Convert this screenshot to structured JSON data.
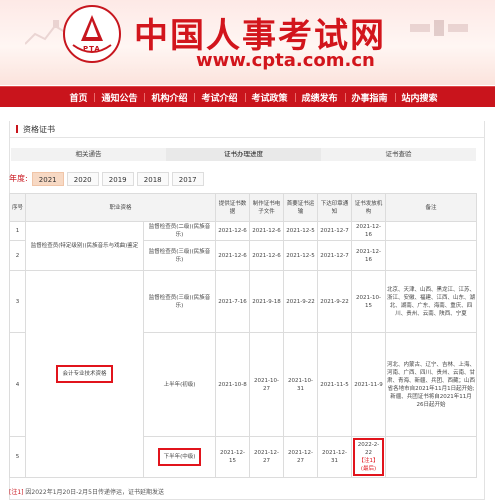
{
  "header": {
    "logo_text": "PTA",
    "site_title": "中国人事考试网",
    "site_url": "www.cpta.com.cn"
  },
  "nav": {
    "items": [
      "首页",
      "通知公告",
      "机构介绍",
      "考试介绍",
      "考试政策",
      "成绩发布",
      "办事指南",
      "站内搜索"
    ]
  },
  "section": {
    "title": "资格证书"
  },
  "tabs": [
    "相关通告",
    "证书办理进度",
    "证书查验"
  ],
  "years": {
    "label": "年度:",
    "options": [
      "2021",
      "2020",
      "2019",
      "2018",
      "2017"
    ],
    "selected": "2021"
  },
  "table": {
    "headers": [
      "序号",
      "职业资格",
      "",
      "提供证书数据",
      "制作证书电子文件",
      "首要证书运输",
      "下达印章通知",
      "证书发放机构",
      "备注"
    ],
    "rows": [
      {
        "no": "1",
        "qual": "监督检查员(特定级别)(民族音乐与戏曲)鉴定",
        "sub": "监督检查员(二级)(民族音乐)",
        "c1": "2021-12-6",
        "c2": "2021-12-6",
        "c3": "2021-12-5",
        "c4": "2021-12-7",
        "c5": "2021-12-16",
        "note": ""
      },
      {
        "no": "2",
        "qual": "",
        "sub": "监督检查员(三级)(民族音乐)",
        "c1": "2021-12-6",
        "c2": "2021-12-6",
        "c3": "2021-12-5",
        "c4": "2021-12-7",
        "c5": "2021-12-16",
        "note": ""
      },
      {
        "no": "3",
        "qual": "",
        "sub": "监督检查员(三级)(民族音乐)",
        "c1": "2021-7-16",
        "c2": "2021-9-18",
        "c3": "2021-9-22",
        "c4": "2021-9-22",
        "c5": "2021-10-15",
        "note": "北京、天津、山西、黑龙江、江苏、浙江、安徽、福建、江西、山东、湖北、湖南、广东、海南、重庆、四川、贵州、云南、陕西、宁夏"
      },
      {
        "no": "4",
        "qual": "会计专业技术资格",
        "sub": "上半年(初级)",
        "c1": "2021-10-8",
        "c2": "2021-10-27",
        "c3": "2021-10-31",
        "c4": "2021-11-5",
        "c5": "2021-11-9",
        "note": "河北、内蒙古、辽宁、吉林、上海、河南、广西、四川、贵州、云南、甘肃、青海、新疆、兵团、西藏；山西省各地市自2021年11月1日起开始;新疆、兵团证书将自2021年11月26日起开始"
      },
      {
        "no": "5",
        "qual": "",
        "sub": "下半年(中级)",
        "c1": "2021-12-15",
        "c2": "2021-12-27",
        "c3": "2021-12-27",
        "c4": "2021-12-31",
        "c5": "2022-2-22",
        "c5b": "【注1】",
        "c5c": "(最后)",
        "note": ""
      }
    ]
  },
  "footnote": {
    "mark": "[注1]",
    "text": "因2022年1月20日-2月5日传递停运，证书延期发送"
  },
  "colors": {
    "brand_red": "#c9141c",
    "highlight_red": "#e1141c"
  }
}
